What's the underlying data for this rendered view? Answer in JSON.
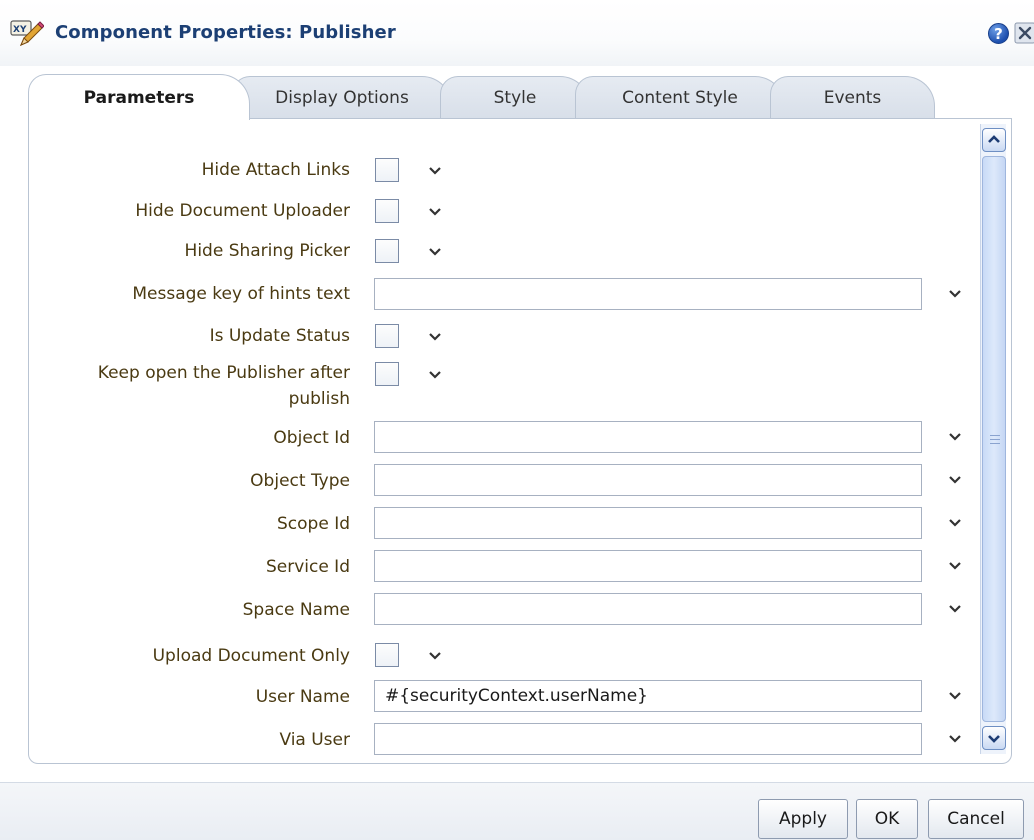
{
  "dialog": {
    "title": "Component Properties: Publisher",
    "help_glyph": "?",
    "title_icon": "properties-xy-pencil-icon"
  },
  "tabs": [
    {
      "label": "Parameters",
      "active": true
    },
    {
      "label": "Display Options",
      "active": false
    },
    {
      "label": "Style",
      "active": false
    },
    {
      "label": "Content Style",
      "active": false
    },
    {
      "label": "Events",
      "active": false
    }
  ],
  "fields": [
    {
      "label": "Hide Attach Links",
      "type": "checkbox",
      "checked": false
    },
    {
      "label": "Hide Document Uploader",
      "type": "checkbox",
      "checked": false
    },
    {
      "label": "Hide Sharing Picker",
      "type": "checkbox",
      "checked": false
    },
    {
      "label": "Message key of hints text",
      "type": "text",
      "value": ""
    },
    {
      "label": "Is Update Status",
      "type": "checkbox",
      "checked": false
    },
    {
      "label_line1": "Keep open the Publisher after",
      "label_line2": "publish",
      "type": "checkbox",
      "checked": false
    },
    {
      "label": "Object Id",
      "type": "text",
      "value": ""
    },
    {
      "label": "Object Type",
      "type": "text",
      "value": ""
    },
    {
      "label": "Scope Id",
      "type": "text",
      "value": ""
    },
    {
      "label": "Service Id",
      "type": "text",
      "value": ""
    },
    {
      "label": "Space Name",
      "type": "text",
      "value": ""
    },
    {
      "label": "Upload Document Only",
      "type": "checkbox",
      "checked": false
    },
    {
      "label": "User Name",
      "type": "text",
      "value": "#{securityContext.userName}"
    },
    {
      "label": "Via User",
      "type": "text",
      "value": ""
    }
  ],
  "footer": {
    "apply_label": "Apply",
    "ok_label": "OK",
    "cancel_label": "Cancel"
  },
  "colors": {
    "title": "#1c3f74",
    "label": "#4a3a12",
    "accent": "#1d4fae"
  }
}
